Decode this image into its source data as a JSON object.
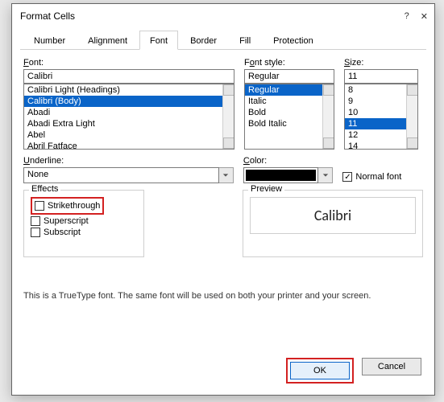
{
  "window": {
    "title": "Format Cells"
  },
  "tabs": {
    "items": [
      "Number",
      "Alignment",
      "Font",
      "Border",
      "Fill",
      "Protection"
    ],
    "active": "Font"
  },
  "font": {
    "label": "Font:",
    "label_ul": "F",
    "value": "Calibri",
    "options": [
      "Calibri Light (Headings)",
      "Calibri (Body)",
      "Abadi",
      "Abadi Extra Light",
      "Abel",
      "Abril Fatface"
    ],
    "selected": "Calibri (Body)"
  },
  "fontstyle": {
    "label": "Font style:",
    "label_ul": "o",
    "value": "Regular",
    "options": [
      "Regular",
      "Italic",
      "Bold",
      "Bold Italic"
    ],
    "selected": "Regular"
  },
  "size": {
    "label": "Size:",
    "label_ul": "S",
    "value": "11",
    "options": [
      "8",
      "9",
      "10",
      "11",
      "12",
      "14"
    ],
    "selected": "11"
  },
  "underline": {
    "label": "Underline:",
    "label_ul": "U",
    "value": "None"
  },
  "color": {
    "label": "Color:",
    "label_ul": "C",
    "value": "#000000"
  },
  "normalfont": {
    "label": "Normal font",
    "label_ul": "N",
    "checked": true
  },
  "effects": {
    "label": "Effects",
    "strikethrough": {
      "label": "Strikethrough",
      "label_ul": "k",
      "checked": false
    },
    "superscript": {
      "label": "Superscript",
      "label_ul": "p",
      "checked": false
    },
    "subscript": {
      "label": "Subscript",
      "label_ul": "b",
      "checked": false
    }
  },
  "preview": {
    "label": "Preview",
    "sample": "Calibri"
  },
  "note": "This is a TrueType font.  The same font will be used on both your printer and your screen.",
  "buttons": {
    "ok": "OK",
    "cancel": "Cancel"
  }
}
